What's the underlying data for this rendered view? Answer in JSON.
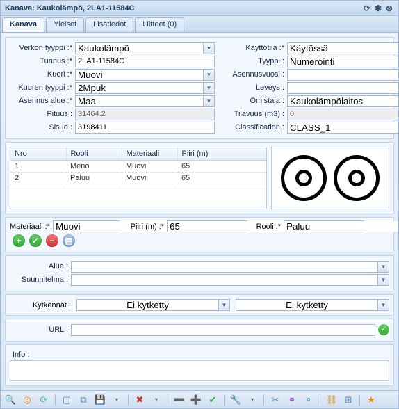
{
  "title": "Kanava: Kaukolämpö, 2LA1-11584C",
  "tabs": {
    "kanava": "Kanava",
    "yleiset": "Yleiset",
    "lisatiedot": "Lisätiedot",
    "liitteet": "Liitteet (0)"
  },
  "left": {
    "verkon_tyyppi": {
      "label": "Verkon tyyppi :*",
      "value": "Kaukolämpö"
    },
    "tunnus": {
      "label": "Tunnus :*",
      "value": "2LA1-11584C"
    },
    "kuori": {
      "label": "Kuori :*",
      "value": "Muovi"
    },
    "kuoren_tyyppi": {
      "label": "Kuoren tyyppi :*",
      "value": "2Mpuk"
    },
    "asennus_alue": {
      "label": "Asennus alue :*",
      "value": "Maa"
    },
    "pituus": {
      "label": "Pituus :",
      "value": "31464.2"
    },
    "sisid": {
      "label": "Sis.Id :",
      "value": "3198411"
    }
  },
  "right": {
    "kayttotila": {
      "label": "Käyttötila :*",
      "value": "Käytössä"
    },
    "tyyppi": {
      "label": "Tyyppi :",
      "value": "Numerointi"
    },
    "asennusvuosi": {
      "label": "Asennusvuosi :",
      "value": ""
    },
    "leveys": {
      "label": "Leveys :",
      "value": ""
    },
    "omistaja": {
      "label": "Omistaja :",
      "value": "Kaukolämpölaitos"
    },
    "tilavuus": {
      "label": "Tilavuus (m3) :",
      "value": "0"
    },
    "classification": {
      "label": "Classification :",
      "value": "CLASS_1"
    }
  },
  "table": {
    "headers": {
      "nro": "Nro",
      "rooli": "Rooli",
      "materiaali": "Materiaali",
      "piiri": "Piiri (m)"
    },
    "rows": [
      {
        "nro": "1",
        "rooli": "Meno",
        "materiaali": "Muovi",
        "piiri": "65"
      },
      {
        "nro": "2",
        "rooli": "Paluu",
        "materiaali": "Muovi",
        "piiri": "65"
      }
    ]
  },
  "subform": {
    "materiaali": {
      "label": "Materiaali :*",
      "value": "Muovi"
    },
    "piiri": {
      "label": "Piiri (m) :*",
      "value": "65"
    },
    "rooli": {
      "label": "Rooli :*",
      "value": "Paluu"
    }
  },
  "alue": {
    "label": "Alue :",
    "value": ""
  },
  "suunnitelma": {
    "label": "Suunnitelma :",
    "value": ""
  },
  "kytkennat": {
    "label": "Kytkennät :",
    "left": "Ei kytketty",
    "right": "Ei kytketty"
  },
  "url": {
    "label": "URL :",
    "value": ""
  },
  "info": {
    "label": "Info :"
  }
}
